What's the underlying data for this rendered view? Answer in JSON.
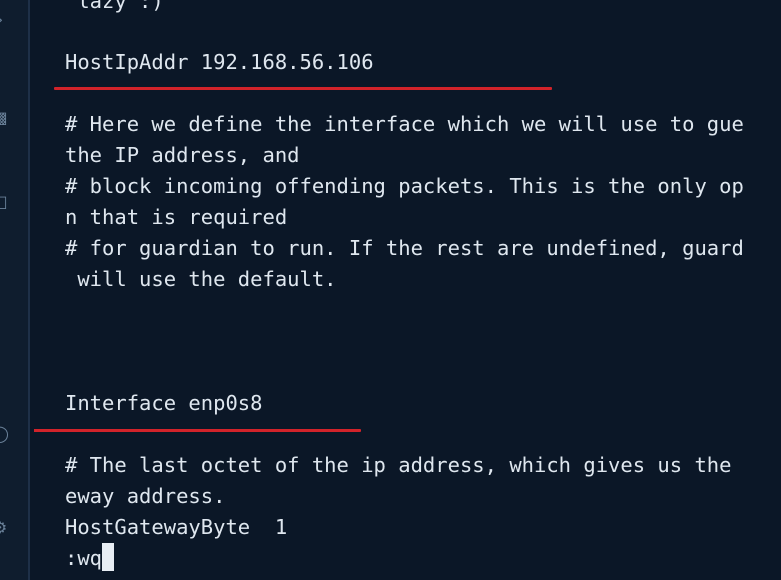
{
  "terminal": {
    "lines": [
      " lazy :)",
      "HostIpAddr 192.168.56.106",
      "# Here we define the interface which we will use to gue",
      "the IP address, and",
      "# block incoming offending packets. This is the only op",
      "n that is required",
      "# for guardian to run. If the rest are undefined, guard",
      " will use the default.",
      "Interface enp0s8",
      "# The last octet of the ip address, which gives us the",
      "eway address.",
      "HostGatewayByte  1",
      ":wq"
    ]
  },
  "gutter": {
    "icons": [
      "chevron-right-icon",
      "file-icon",
      "square-icon",
      "circle-icon",
      "gear-icon"
    ]
  },
  "colors": {
    "background": "#0b1727",
    "text": "#dfe7ef",
    "underline": "#d2232a"
  }
}
